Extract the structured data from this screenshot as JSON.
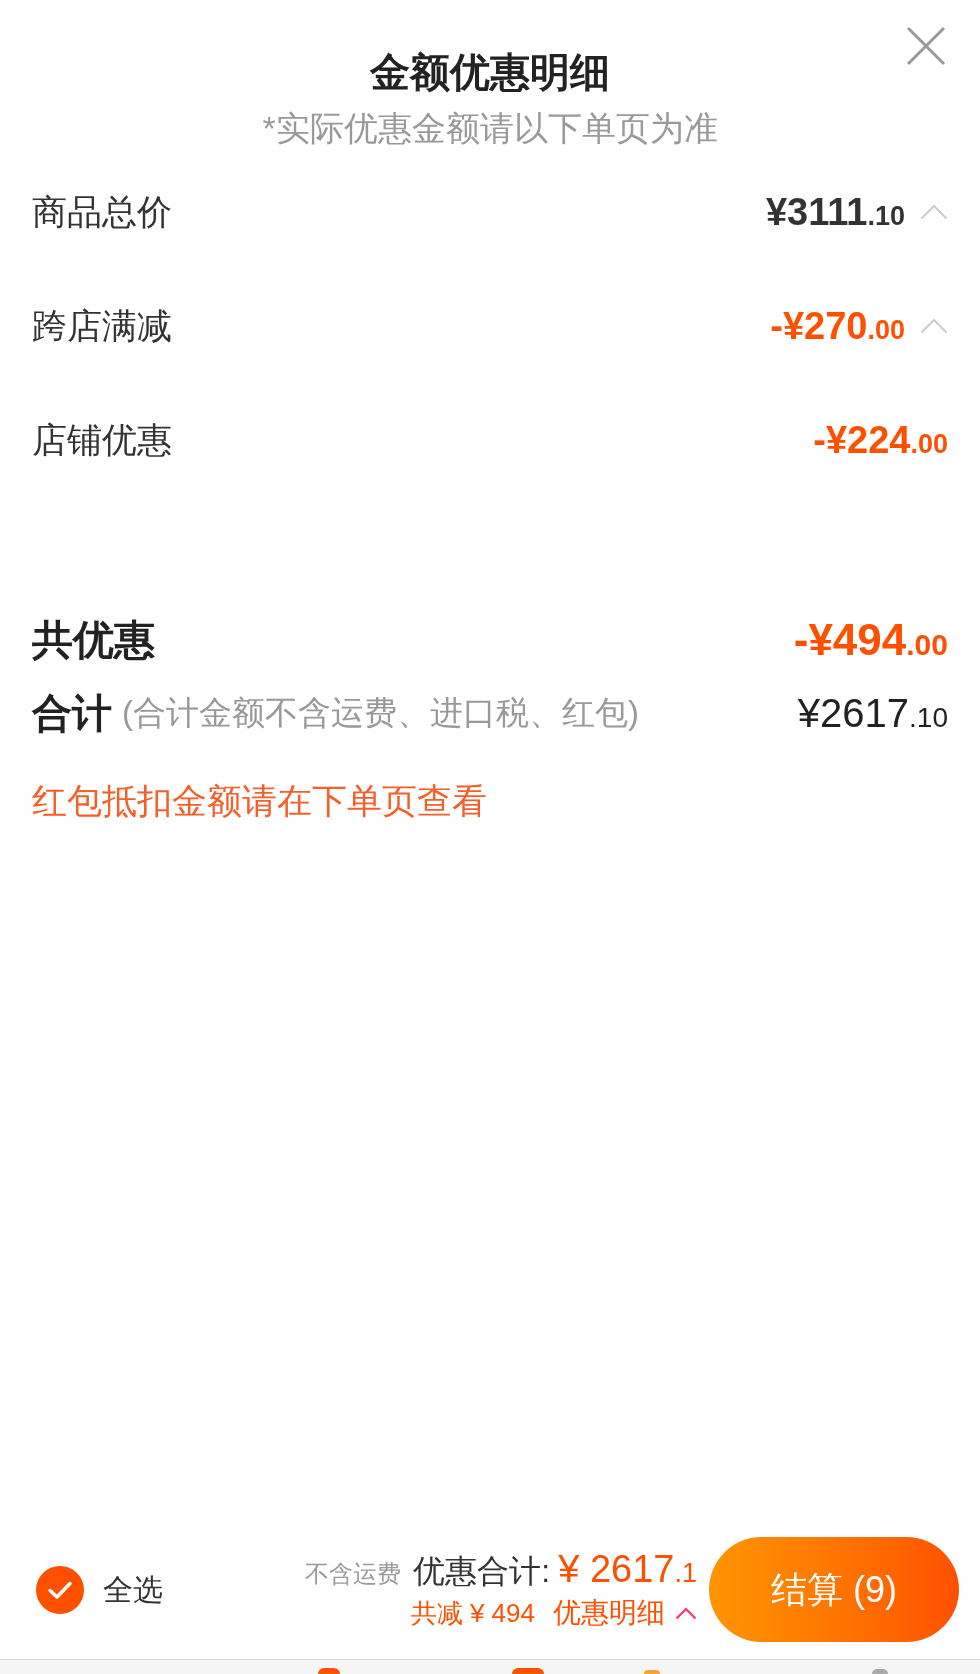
{
  "header": {
    "title": "金额优惠明细",
    "subtitle": "*实际优惠金额请以下单页为准"
  },
  "items": [
    {
      "label": "商品总价",
      "amount": "¥3111.10",
      "kind": "price",
      "expandable": true
    },
    {
      "label": "跨店满减",
      "amount": "-¥270.00",
      "kind": "discount",
      "expandable": true
    },
    {
      "label": "店铺优惠",
      "amount": "-¥224.00",
      "kind": "discount",
      "expandable": false
    }
  ],
  "summary": {
    "discount_label": "共优惠",
    "discount_amount": "-¥494.00",
    "total_label": "合计",
    "total_note": "(合计金额不含运费、进口税、红包)",
    "total_amount": "¥2617.10",
    "notice": "红包抵扣金额请在下单页查看"
  },
  "bottom_bar": {
    "select_all": {
      "label": "全选",
      "checked": true
    },
    "shipping_note": "不含运费",
    "total_label": "优惠合计:",
    "total_amount": "¥ 2617.1",
    "saved": "共减 ¥ 494",
    "details_link": "优惠明细",
    "checkout_button": "结算 (9)"
  }
}
